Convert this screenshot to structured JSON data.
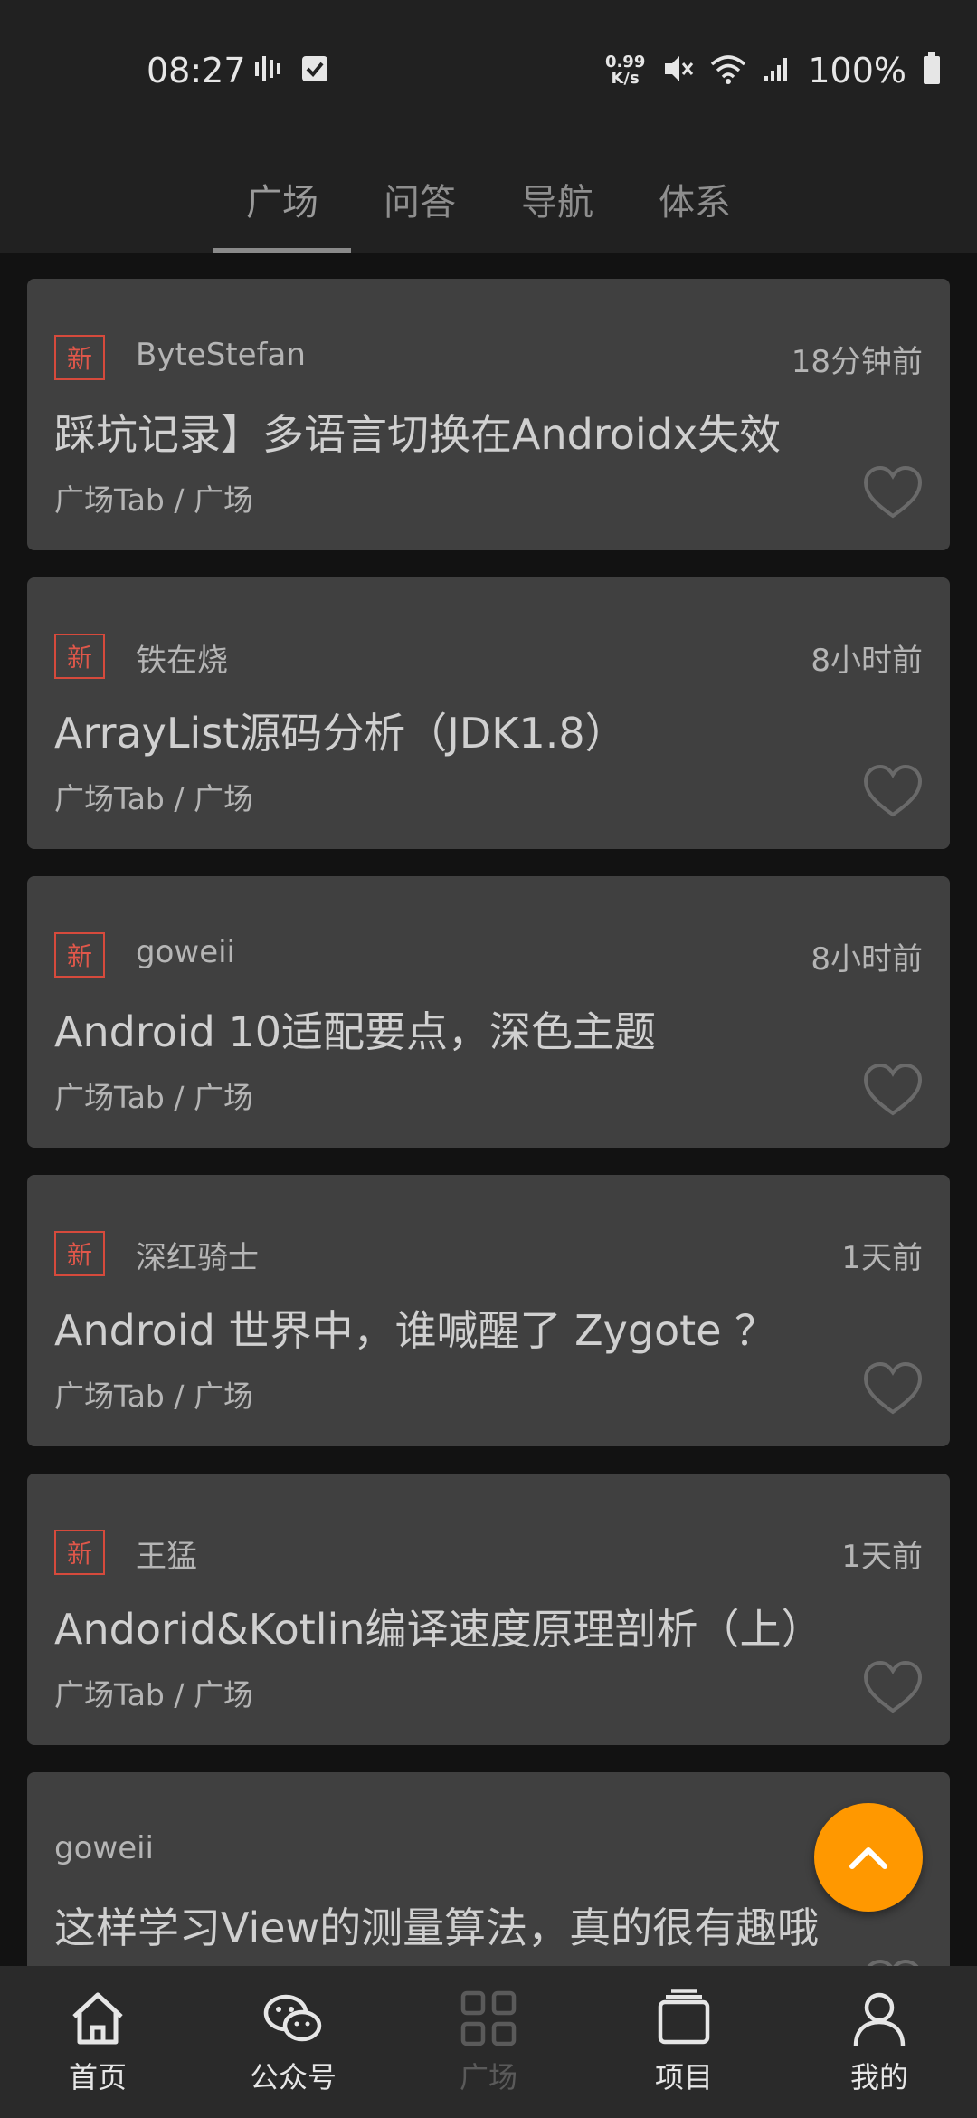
{
  "status_bar": {
    "time": "08:27",
    "speed_value": "0.99",
    "speed_unit": "K/s",
    "battery": "100%"
  },
  "tabs": [
    {
      "label": "广场",
      "active": true
    },
    {
      "label": "问答",
      "active": false
    },
    {
      "label": "导航",
      "active": false
    },
    {
      "label": "体系",
      "active": false
    }
  ],
  "articles": [
    {
      "badge": "新",
      "author": "ByteStefan",
      "time": "18分钟前",
      "title": "踩坑记录】多语言切换在Androidx失效",
      "chapter": "广场Tab / 广场"
    },
    {
      "badge": "新",
      "author": "铁在烧",
      "time": "8小时前",
      "title": "ArrayList源码分析（JDK1.8）",
      "chapter": "广场Tab / 广场"
    },
    {
      "badge": "新",
      "author": "goweii",
      "time": "8小时前",
      "title": "Android 10适配要点，深色主题",
      "chapter": "广场Tab / 广场"
    },
    {
      "badge": "新",
      "author": "深红骑士",
      "time": "1天前",
      "title": "Android 世界中，谁喊醒了 Zygote ？",
      "chapter": "广场Tab / 广场"
    },
    {
      "badge": "新",
      "author": "王猛",
      "time": "1天前",
      "title": "Andorid&Kotlin编译速度原理剖析（上）",
      "chapter": "广场Tab / 广场"
    },
    {
      "badge": "",
      "author": "goweii",
      "time": "",
      "title": "这样学习View的测量算法，真的很有趣哦",
      "chapter": ""
    }
  ],
  "bottom_nav": [
    {
      "label": "首页",
      "icon": "home-icon",
      "active": false
    },
    {
      "label": "公众号",
      "icon": "wechat-icon",
      "active": false
    },
    {
      "label": "广场",
      "icon": "grid-icon",
      "active": true
    },
    {
      "label": "项目",
      "icon": "project-icon",
      "active": false
    },
    {
      "label": "我的",
      "icon": "person-icon",
      "active": false
    }
  ],
  "colors": {
    "accent_fab": "#ff9800",
    "badge_red": "#e0574a",
    "card_bg": "#404040"
  }
}
